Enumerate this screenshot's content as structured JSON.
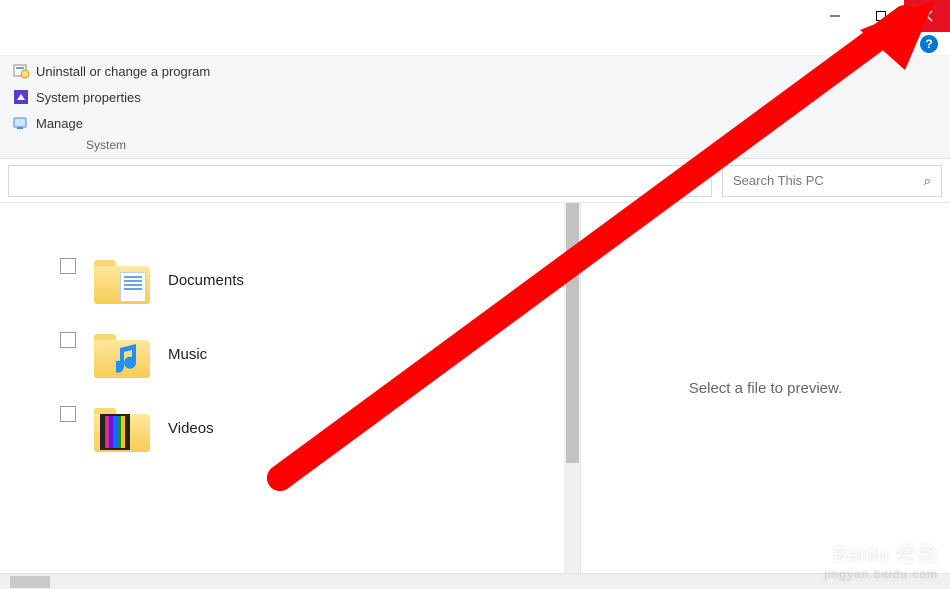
{
  "titlebar": {
    "minimize": "—",
    "maximize": "❐",
    "close": "✕"
  },
  "ribbon": {
    "commands": {
      "uninstall": "Uninstall or change a program",
      "properties": "System properties",
      "manage": "Manage"
    },
    "group_label": "System",
    "help_glyph": "?",
    "collapse_glyph": "ˇ"
  },
  "address": {
    "refresh_glyph": "↻"
  },
  "search": {
    "placeholder": "Search This PC",
    "icon_glyph": "⌕"
  },
  "folders": [
    {
      "label": "Documents",
      "kind": "documents"
    },
    {
      "label": "Music",
      "kind": "music"
    },
    {
      "label": "Videos",
      "kind": "videos"
    }
  ],
  "preview": {
    "message": "Select a file to preview."
  },
  "watermark": {
    "brand": "Baidu 经验",
    "sub": "jingyan.baidu.com"
  },
  "annotation": {
    "description": "Large red arrow pointing from lower-left content area to the window Close button",
    "color": "#ff0000"
  }
}
